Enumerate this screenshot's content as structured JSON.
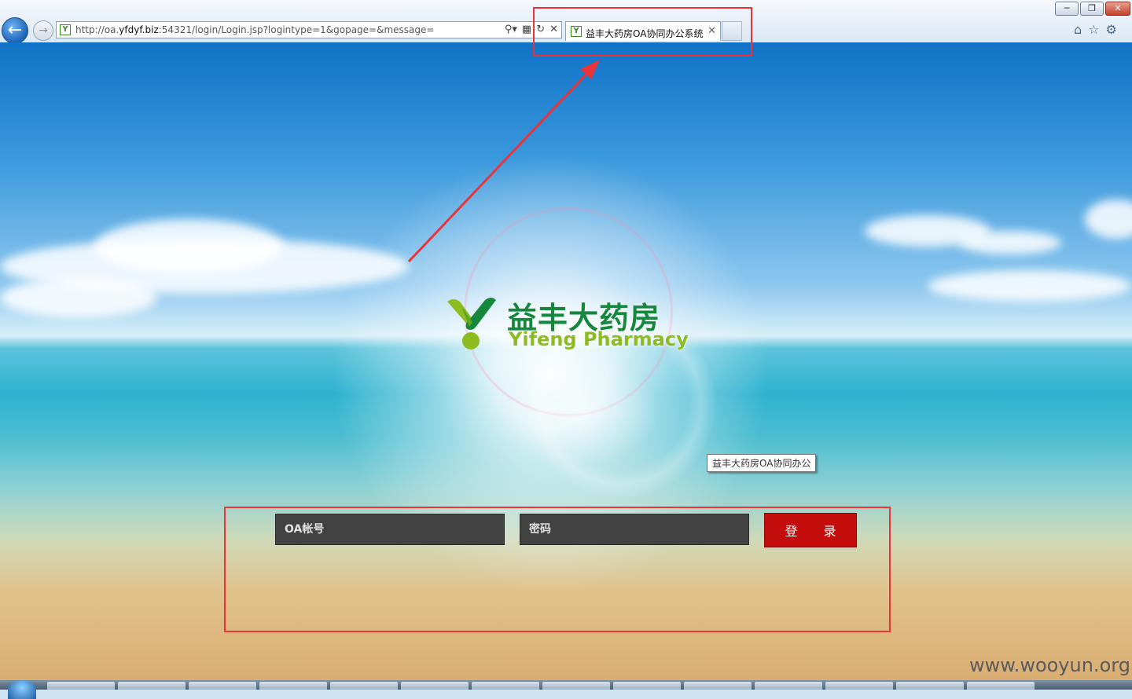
{
  "browser": {
    "url_prefix": "http://oa.",
    "url_domain": "yfdyf.biz",
    "url_suffix": ":54321/login/Login.jsp?logintype=1&gopage=&message=",
    "tab_title": "益丰大药房OA协同办公系统",
    "favicon_letter": "Y",
    "icons": {
      "back": "back-arrow-icon",
      "forward": "forward-arrow-icon",
      "search": "search-icon",
      "compat": "compatibility-view-icon",
      "refresh": "refresh-icon",
      "stop": "stop-icon",
      "home": "home-icon",
      "favorites": "star-icon",
      "tools": "gear-icon"
    }
  },
  "logo": {
    "name_cn": "益丰大药房",
    "name_en": "Yifeng Pharmacy",
    "colors": {
      "green": "#16883d",
      "lime": "#8dbb22"
    }
  },
  "tooltip": "益丰大药房OA协同办公",
  "login": {
    "username_placeholder": "OA帐号",
    "password_placeholder": "密码",
    "submit_label": "登 录",
    "button_color": "#c30d0d"
  },
  "annotation_color": "#e8343a",
  "watermark": "www.wooyun.org"
}
